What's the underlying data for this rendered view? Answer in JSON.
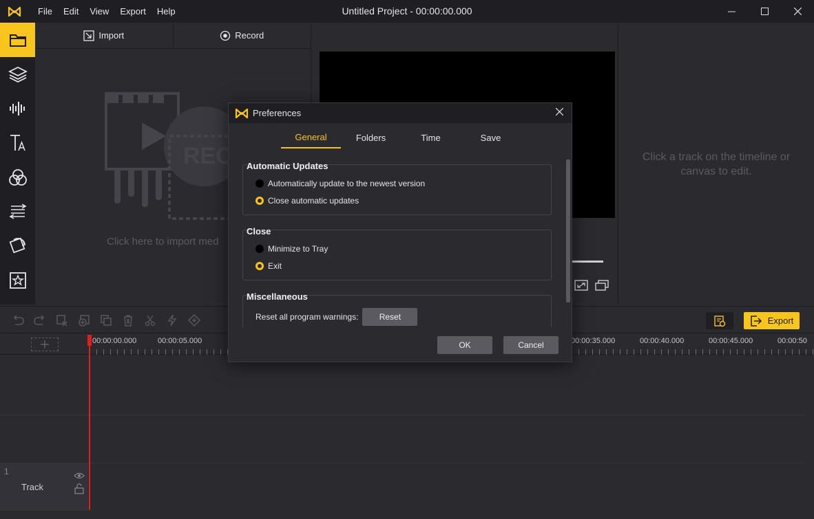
{
  "app": {
    "title": "Untitled Project - 00:00:00.000",
    "brand_color": "#f7c51e"
  },
  "menu": {
    "items": [
      "File",
      "Edit",
      "View",
      "Export",
      "Help"
    ]
  },
  "window_controls": {
    "minimize": "minimize-icon",
    "maximize": "maximize-icon",
    "close": "close-icon"
  },
  "sidebar": {
    "items": [
      {
        "icon": "folder-icon",
        "active": true
      },
      {
        "icon": "layers-icon",
        "active": false
      },
      {
        "icon": "audio-wave-icon",
        "active": false
      },
      {
        "icon": "text-icon",
        "active": false
      },
      {
        "icon": "filters-icon",
        "active": false
      },
      {
        "icon": "transitions-icon",
        "active": false
      },
      {
        "icon": "overlay-icon",
        "active": false
      },
      {
        "icon": "elements-icon",
        "active": false
      }
    ]
  },
  "media": {
    "import_label": "Import",
    "record_label": "Record",
    "hint": "Click here to import med"
  },
  "properties": {
    "hint_line1": "Click a track on the timeline or",
    "hint_line2": "canvas to edit."
  },
  "timeline": {
    "export_label": "Export",
    "time_labels": [
      "00:00:00.000",
      "00:00:05.000",
      "00:00:35.000",
      "00:00:40.000",
      "00:00:45.000",
      "00:00:50"
    ],
    "track": {
      "number": "1",
      "name": "Track"
    }
  },
  "dialog": {
    "title": "Preferences",
    "tabs": [
      {
        "label": "General",
        "active": true
      },
      {
        "label": "Folders",
        "active": false
      },
      {
        "label": "Time",
        "active": false
      },
      {
        "label": "Save",
        "active": false
      }
    ],
    "groups": {
      "updates": {
        "title": "Automatic Updates",
        "options": [
          {
            "label": "Automatically update to the newest version",
            "checked": false
          },
          {
            "label": "Close automatic updates",
            "checked": true
          }
        ]
      },
      "close": {
        "title": "Close",
        "options": [
          {
            "label": "Minimize to Tray",
            "checked": false
          },
          {
            "label": "Exit",
            "checked": true
          }
        ]
      },
      "misc": {
        "title": "Miscellaneous",
        "reset_text": "Reset all program warnings:",
        "reset_button": "Reset"
      }
    },
    "ok_label": "OK",
    "cancel_label": "Cancel"
  }
}
